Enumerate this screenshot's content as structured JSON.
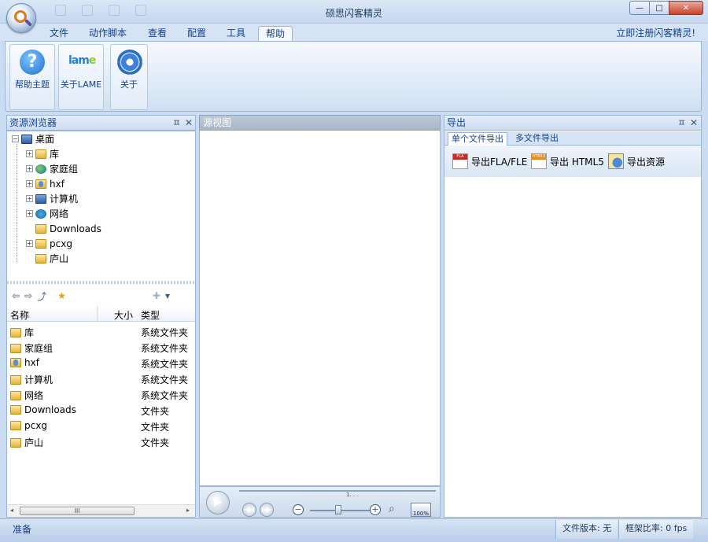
{
  "window": {
    "title": "硕思闪客精灵",
    "controls": {
      "minimize": "—",
      "maximize": "□",
      "close": "✕"
    }
  },
  "ribbon": {
    "tabs": [
      {
        "label": "文件"
      },
      {
        "label": "动作脚本"
      },
      {
        "label": "查看"
      },
      {
        "label": "配置"
      },
      {
        "label": "工具"
      },
      {
        "label": "帮助",
        "active": true
      }
    ],
    "register_link": "立即注册闪客精灵!",
    "buttons": [
      {
        "label": "帮助主题",
        "icon": "help-icon"
      },
      {
        "label": "关于LAME",
        "icon": "lame-icon"
      },
      {
        "label": "关于",
        "icon": "gear-icon"
      }
    ],
    "lame_logo": {
      "text": "lam",
      "accent": "e"
    }
  },
  "resource_browser": {
    "title": "资源浏览器",
    "pin": "ㅍ",
    "close": "✕",
    "tree": [
      {
        "label": "桌面",
        "icon": "desktop-icon",
        "level": 0,
        "expander": "−"
      },
      {
        "label": "库",
        "icon": "library-icon",
        "level": 1,
        "expander": "+"
      },
      {
        "label": "家庭组",
        "icon": "homegroup-icon",
        "level": 1,
        "expander": "+"
      },
      {
        "label": "hxf",
        "icon": "user-folder-icon",
        "level": 1,
        "expander": "+"
      },
      {
        "label": "计算机",
        "icon": "computer-icon",
        "level": 1,
        "expander": "+"
      },
      {
        "label": "网络",
        "icon": "network-icon",
        "level": 1,
        "expander": "+"
      },
      {
        "label": "Downloads",
        "icon": "folder-icon",
        "level": 1,
        "expander": ""
      },
      {
        "label": "pcxg",
        "icon": "folder-icon",
        "level": 1,
        "expander": "+"
      },
      {
        "label": "庐山",
        "icon": "folder-icon",
        "level": 1,
        "expander": ""
      }
    ],
    "nav": {
      "back": "⇦",
      "forward": "⇨",
      "up": "⤴",
      "favorite": "★",
      "add": "✚",
      "dropdown": "▾"
    },
    "list_headers": {
      "name": "名称",
      "size": "大小",
      "type": "类型"
    },
    "list_rows": [
      {
        "name": "库",
        "type": "系统文件夹"
      },
      {
        "name": "家庭组",
        "type": "系统文件夹"
      },
      {
        "name": "hxf",
        "type": "系统文件夹"
      },
      {
        "name": "计算机",
        "type": "系统文件夹"
      },
      {
        "name": "网络",
        "type": "系统文件夹"
      },
      {
        "name": "Downloads",
        "type": "文件夹"
      },
      {
        "name": "pcxg",
        "type": "文件夹"
      },
      {
        "name": "庐山",
        "type": "文件夹"
      }
    ],
    "scroll": {
      "left": "◂",
      "right": "▸",
      "grip": "III"
    }
  },
  "source_view": {
    "title": "源视图",
    "timeline": {
      "play": "▶",
      "rewind": "◀◀",
      "forward": "▶▶",
      "zoom_out": "−",
      "zoom_in": "+",
      "zoom_pct": "100%",
      "tick_label": "1. . ."
    }
  },
  "export_panel": {
    "title": "导出",
    "pin": "ㅍ",
    "close": "✕",
    "tabs": [
      {
        "label": "单个文件导出",
        "active": true
      },
      {
        "label": "多文件导出"
      }
    ],
    "buttons": [
      {
        "label": "导出FLA/FLE",
        "icon": "fla-file-icon"
      },
      {
        "label": "导出 HTML5",
        "icon": "html5-file-icon"
      },
      {
        "label": "导出资源",
        "icon": "resource-export-icon"
      }
    ]
  },
  "status_bar": {
    "ready": "准备",
    "file_version": "文件版本: 无",
    "frame_rate": "框架比率: 0 fps"
  }
}
